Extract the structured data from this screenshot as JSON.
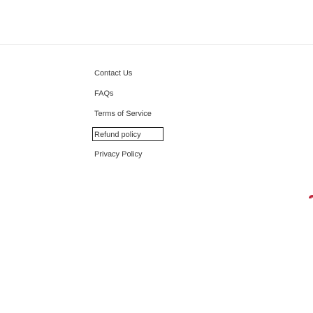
{
  "footer": {
    "links": [
      {
        "label": "Contact Us"
      },
      {
        "label": "FAQs"
      },
      {
        "label": "Terms of Service"
      },
      {
        "label": "Refund policy",
        "focused": true
      },
      {
        "label": "Privacy Policy"
      }
    ]
  },
  "colors": {
    "background": "#ffffff",
    "link_text": "#3a3a3a",
    "focus_outline": "#1a1a1a",
    "edge_mark": "#c0263a"
  },
  "icons": {
    "edge_mark": "partial-red-icon"
  }
}
